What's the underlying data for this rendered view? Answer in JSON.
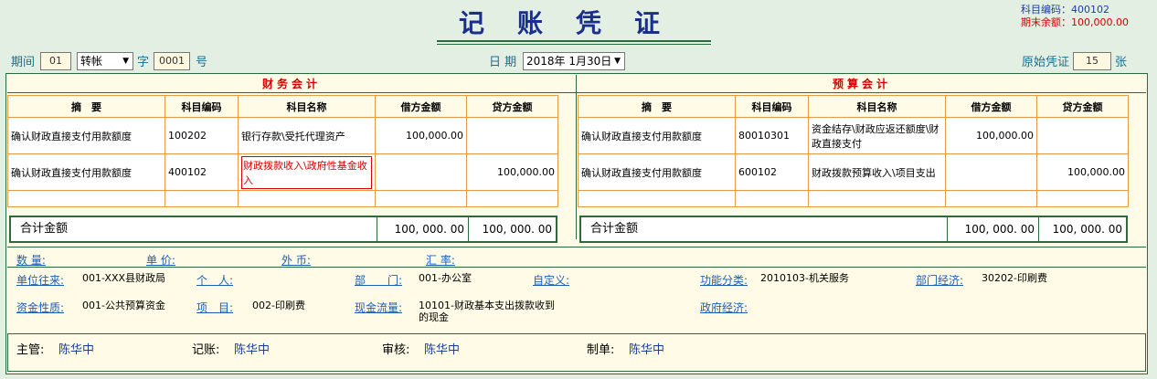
{
  "header": {
    "title": "记账凭证",
    "subject_code": "科目编码：400102",
    "period_end_balance": "期末余额：100,000.00"
  },
  "meta": {
    "period_label": "期间",
    "period_value": "01",
    "type_value": "转帐",
    "zi_label": "字",
    "number_value": "0001",
    "hao_label": "号",
    "date_label": "日 期",
    "date_value": "2018年 1月30日",
    "orig_label": "原始凭证",
    "orig_value": "15",
    "zhang_label": "张"
  },
  "finance": {
    "title": "财务会计",
    "headers": [
      "摘　要",
      "科目编码",
      "科目名称",
      "借方金额",
      "贷方金额"
    ],
    "rows": [
      [
        "确认财政直接支付用款额度",
        "100202",
        "银行存款\\受托代理资产",
        "100,000.00",
        ""
      ],
      [
        "确认财政直接支付用款额度",
        "400102",
        "财政拨款收入\\政府性基金收入",
        "",
        "100,000.00"
      ]
    ],
    "total_label": "合计金额",
    "total_debit": "100, 000. 00",
    "total_credit": "100, 000. 00"
  },
  "budget": {
    "title": "预算会计",
    "headers": [
      "摘　要",
      "科目编码",
      "科目名称",
      "借方金额",
      "贷方金额"
    ],
    "rows": [
      [
        "确认财政直接支付用款额度",
        "80010301",
        "资金结存\\财政应返还额度\\财政直接支付",
        "100,000.00",
        ""
      ],
      [
        "确认财政直接支付用款额度",
        "600102",
        "财政拨款预算收入\\项目支出",
        "",
        "100,000.00"
      ]
    ],
    "total_label": "合计金额",
    "total_debit": "100, 000. 00",
    "total_credit": "100, 000. 00"
  },
  "aux": {
    "quantity_label": "数 量:",
    "unit_price_label": "单 价:",
    "currency_label": "外 币:",
    "rate_label": "汇 率:",
    "unit_contact_label": "单位往来:",
    "unit_contact_value": "001-XXX县财政局",
    "person_label": "个　人:",
    "dept_label": "部　　门:",
    "dept_value": "001-办公室",
    "custom_label": "自定义:",
    "func_label": "功能分类:",
    "func_value": "2010103-机关服务",
    "dept_econ_label": "部门经济:",
    "dept_econ_value": "30202-印刷费",
    "fund_label": "资金性质:",
    "fund_value": "001-公共预算资金",
    "project_label": "项　目:",
    "project_value": "002-印刷费",
    "cashflow_label": "现金流量:",
    "cashflow_value_1": "10101-财政基本支出拨款收到",
    "cashflow_value_2": "的现金",
    "gov_econ_label": "政府经济:"
  },
  "footer": {
    "supervisor_label": "主管:",
    "supervisor": "陈华中",
    "bookkeeper_label": "记账:",
    "bookkeeper": "陈华中",
    "auditor_label": "审核:",
    "auditor": "陈华中",
    "maker_label": "制单:",
    "maker": "陈华中"
  }
}
